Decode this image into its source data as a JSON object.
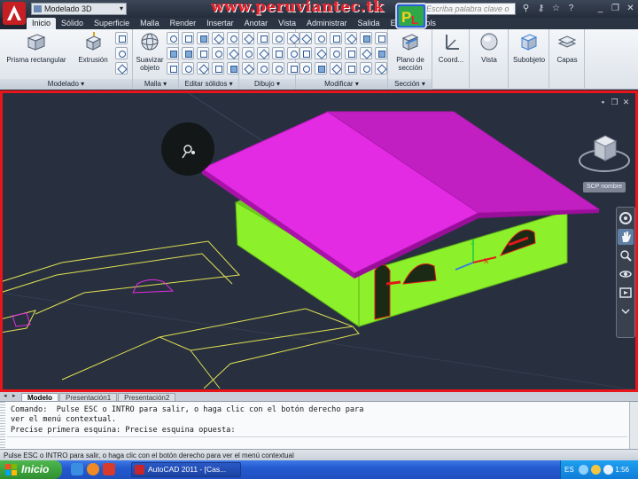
{
  "title_bar": {
    "workspace": "Modelado 3D",
    "watermark": "www.peruviantec.tk",
    "search_placeholder": "Escriba palabra clave o frase"
  },
  "ribbon_tabs": [
    "Inicio",
    "Sólido",
    "Superficie",
    "Malla",
    "Render",
    "Insertar",
    "Anotar",
    "Vista",
    "Administrar",
    "Salida",
    "Expres Tools"
  ],
  "ribbon": {
    "panels": {
      "modelado": "Modelado",
      "malla": "Malla",
      "editar_solidos": "Editar sólidos",
      "dibujo": "Dibujo",
      "modificar": "Modificar",
      "seccion": "Sección"
    },
    "buttons": {
      "prisma": "Prisma rectangular",
      "extrusion": "Extrusión",
      "suavizar": "Suavizar objeto",
      "plano_seccion": "Plano de sección",
      "coord": "Coord...",
      "vista": "Vista",
      "subobjeto": "Subobjeto",
      "capas": "Capas"
    }
  },
  "viewport": {
    "wcs_label": "SCP nombre",
    "colors": {
      "background": "#283040",
      "frame": "#e8161b",
      "walls": "#8cf02a",
      "roof": "#e22be2",
      "lines": "#e0e050",
      "accent_red": "#e11a1a"
    }
  },
  "layout_tabs": [
    "Modelo",
    "Presentación1",
    "Presentación2"
  ],
  "command_line": {
    "lines": [
      "Comando:  Pulse ESC o INTRO para salir, o haga clic con el botón derecho para",
      "ver el menú contextual.",
      "Precise primera esquina: Precise esquina opuesta:"
    ]
  },
  "status_bar": "Pulse ESC o INTRO para salir, o haga clic con el botón derecho para ver el menú contextual",
  "taskbar": {
    "start": "Inicio",
    "task": "AutoCAD 2011 - [Cas...",
    "lang": "ES",
    "clock": "1:56"
  }
}
